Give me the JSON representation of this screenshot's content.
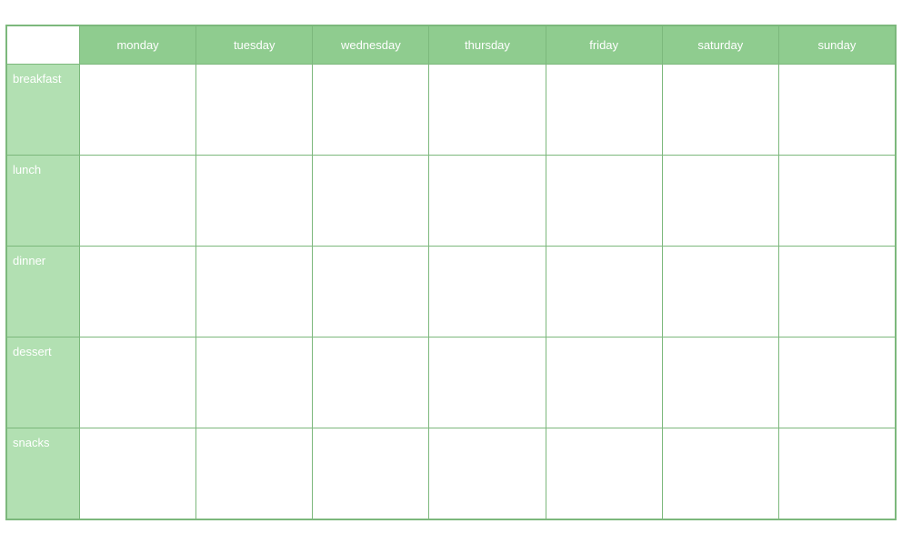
{
  "table": {
    "columns": [
      {
        "key": "label",
        "label": ""
      },
      {
        "key": "monday",
        "label": "monday"
      },
      {
        "key": "tuesday",
        "label": "tuesday"
      },
      {
        "key": "wednesday",
        "label": "wednesday"
      },
      {
        "key": "thursday",
        "label": "thursday"
      },
      {
        "key": "friday",
        "label": "friday"
      },
      {
        "key": "saturday",
        "label": "saturday"
      },
      {
        "key": "sunday",
        "label": "sunday"
      }
    ],
    "rows": [
      {
        "label": "breakfast"
      },
      {
        "label": "lunch"
      },
      {
        "label": "dinner"
      },
      {
        "label": "dessert"
      },
      {
        "label": "snacks"
      }
    ]
  },
  "colors": {
    "header_bg": "#8fcc8f",
    "row_label_bg": "#b2e0b2",
    "border": "#7cb87c",
    "text_white": "#ffffff"
  }
}
